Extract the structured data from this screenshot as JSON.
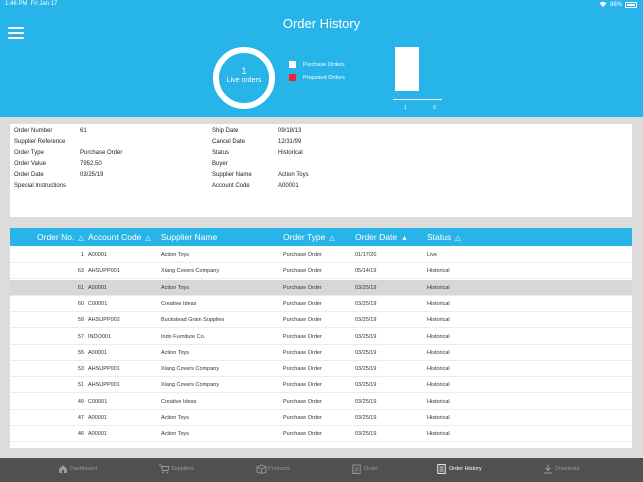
{
  "status_bar": {
    "time": "1:46 PM",
    "date": "Fri Jan 17",
    "battery": "98%"
  },
  "header": {
    "title": "Order History",
    "live_count": "1",
    "live_label": "Live orders",
    "legend": [
      {
        "label": "Purchase Orders",
        "color": "#ffffff"
      },
      {
        "label": "Proposed Orders",
        "color": "#e8262b"
      }
    ],
    "bar_chart": {
      "values": [
        1,
        0
      ],
      "labels": [
        "1",
        "0"
      ]
    }
  },
  "details": {
    "left": [
      {
        "key": "Order Number",
        "value": "61"
      },
      {
        "key": "Supplier Reference",
        "value": ""
      },
      {
        "key": "Order Type",
        "value": "Purchase Order"
      },
      {
        "key": "Order Value",
        "value": "7952.50"
      },
      {
        "key": "Order Date",
        "value": "03/25/19"
      },
      {
        "key": "Special Instructions",
        "value": ""
      }
    ],
    "right": [
      {
        "key": "Ship Date",
        "value": "09/18/13"
      },
      {
        "key": "Cancel Date",
        "value": "12/31/99"
      },
      {
        "key": "Status",
        "value": "Historical"
      },
      {
        "key": "Buyer",
        "value": ""
      },
      {
        "key": "Supplier Name",
        "value": "Action Toys"
      },
      {
        "key": "Account Code",
        "value": "A00001"
      }
    ]
  },
  "table": {
    "columns": [
      {
        "label": "Order No.",
        "sort": "△"
      },
      {
        "label": "Account Code",
        "sort": "△"
      },
      {
        "label": "Supplier Name",
        "sort": ""
      },
      {
        "label": "Order Type",
        "sort": "△"
      },
      {
        "label": "Order Date",
        "sort": "▲"
      },
      {
        "label": "Status",
        "sort": "△"
      }
    ],
    "selected_index": 2,
    "rows": [
      [
        "1",
        "A00001",
        "Action Toys",
        "Purchase Order",
        "01/17/20",
        "Live"
      ],
      [
        "63",
        "AHSUPP001",
        "Xiang Covers Company",
        "Purchase Order",
        "05/14/19",
        "Historical"
      ],
      [
        "61",
        "A00001",
        "Action Toys",
        "Purchase Order",
        "03/25/19",
        "Historical"
      ],
      [
        "60",
        "C00001",
        "Creative Ideas",
        "Purchase Order",
        "03/25/19",
        "Historical"
      ],
      [
        "59",
        "AHSUPP002",
        "Buckstead Grain Supplies",
        "Purchase Order",
        "03/25/19",
        "Historical"
      ],
      [
        "57",
        "INDO001",
        "Indo Furniture Co.",
        "Purchase Order",
        "03/25/19",
        "Historical"
      ],
      [
        "55",
        "A00001",
        "Action Toys",
        "Purchase Order",
        "03/25/19",
        "Historical"
      ],
      [
        "53",
        "AHSUPP001",
        "Xiang Covers Company",
        "Purchase Order",
        "03/25/19",
        "Historical"
      ],
      [
        "51",
        "AHSUPP001",
        "Xiang Covers Company",
        "Purchase Order",
        "03/25/19",
        "Historical"
      ],
      [
        "49",
        "C00001",
        "Creative Ideas",
        "Purchase Order",
        "03/25/19",
        "Historical"
      ],
      [
        "47",
        "A00001",
        "Action Toys",
        "Purchase Order",
        "03/25/19",
        "Historical"
      ],
      [
        "46",
        "A00001",
        "Action Toys",
        "Purchase Order",
        "03/25/19",
        "Historical"
      ]
    ]
  },
  "tabbar": {
    "active_index": 4,
    "tabs": [
      {
        "label": "Dashboard",
        "icon": "house-icon"
      },
      {
        "label": "Suppliers",
        "icon": "cart-icon"
      },
      {
        "label": "Products",
        "icon": "box-icon"
      },
      {
        "label": "Order",
        "icon": "clipboard-icon"
      },
      {
        "label": "Order History",
        "icon": "document-icon"
      },
      {
        "label": "Download",
        "icon": "download-icon"
      }
    ]
  }
}
